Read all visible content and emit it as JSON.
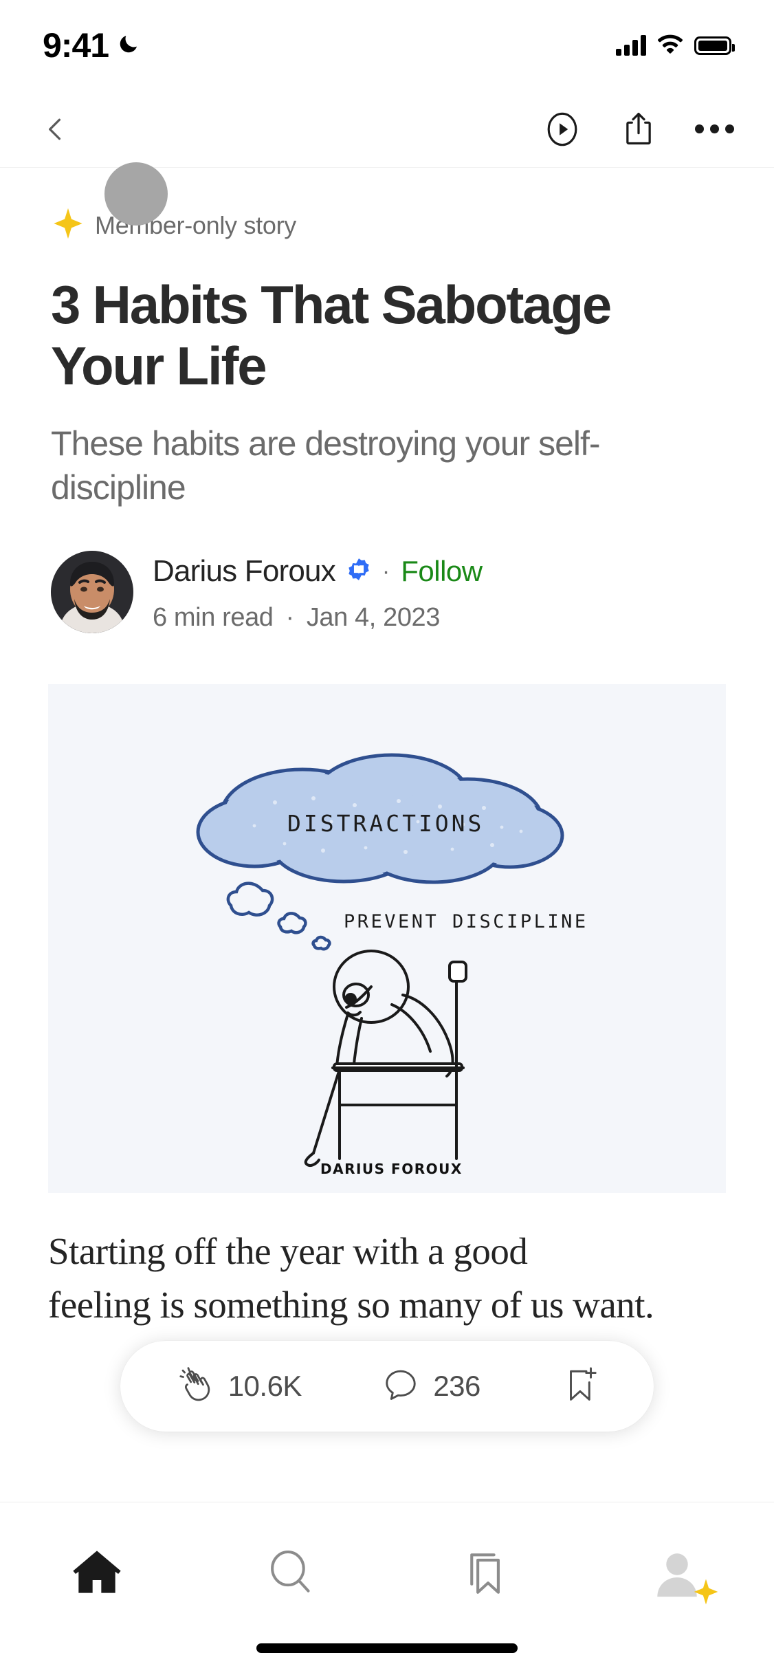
{
  "status_bar": {
    "time": "9:41",
    "dnd_icon": "moon-icon",
    "signal_icon": "cellular-signal-icon",
    "wifi_icon": "wifi-icon",
    "battery_icon": "battery-full-icon"
  },
  "navbar": {
    "back_icon": "back-chevron-icon",
    "listen_icon": "play-circle-icon",
    "share_icon": "share-icon",
    "more_icon": "more-horizontal-icon"
  },
  "article": {
    "member_badge": {
      "icon": "star-four-point-icon",
      "label": "Member-only story"
    },
    "title": "3 Habits That Sabotage Your Life",
    "subtitle": "These habits are destroying your self-discipline",
    "author": {
      "name": "Darius Foroux",
      "verified_icon": "verified-writer-badge-icon",
      "separator": "·",
      "follow_label": "Follow",
      "read_time": "6  min read",
      "meta_separator": "·",
      "date": "Jan 4, 2023"
    },
    "hero_image": {
      "alt": "distractions-prevent-discipline-illustration",
      "cloud_text": "DISTRACTIONS",
      "caption_text": "PREVENT DISCIPLINE",
      "signature": "DARIUS FOROUX",
      "background_color": "#f4f6fa",
      "cloud_fill": "#b9cdeb",
      "cloud_stroke": "#2f4f8f"
    },
    "body_line_1": "Starting off the year with a good",
    "body_line_2": "feeling is something so many of us want."
  },
  "action_bar": {
    "clap_icon": "clap-icon",
    "clap_count": "10.6K",
    "comment_icon": "comment-icon",
    "comment_count": "236",
    "bookmark_icon": "bookmark-add-icon"
  },
  "tabbar": {
    "items": [
      {
        "name": "home",
        "icon": "home-icon",
        "active": true
      },
      {
        "name": "search",
        "icon": "search-icon",
        "active": false
      },
      {
        "name": "library",
        "icon": "bookmarks-icon",
        "active": false
      },
      {
        "name": "profile",
        "icon": "profile-avatar-icon",
        "active": false
      }
    ],
    "profile_badge_icon": "star-four-point-icon"
  },
  "colors": {
    "accent_green": "#1a8917",
    "star_yellow": "#f5c518",
    "text_primary": "#242424",
    "text_secondary": "#6b6b6b",
    "verified_blue": "#2f6df6"
  }
}
